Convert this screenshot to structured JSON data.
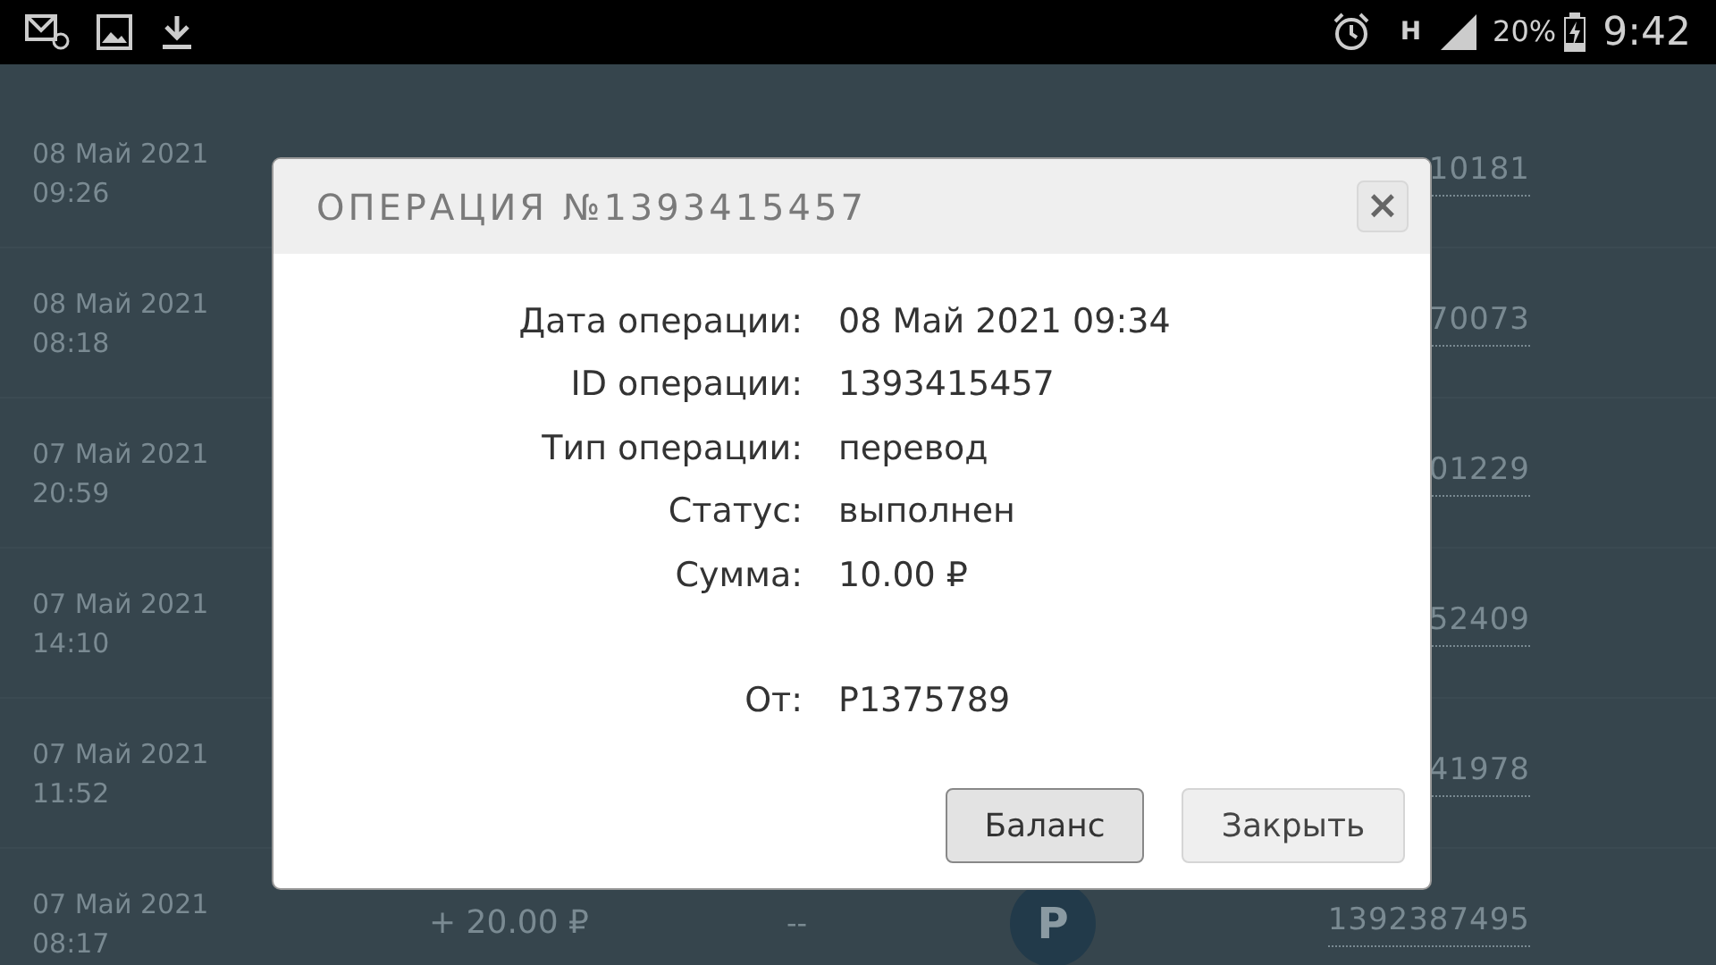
{
  "status_bar": {
    "network": "H",
    "battery": "20%",
    "time": "9:42"
  },
  "operations": [
    {
      "date": "08 Май 2021",
      "time": "09:26",
      "number": "10181"
    },
    {
      "date": "08 Май 2021",
      "time": "08:18",
      "number": "70073"
    },
    {
      "date": "07 Май 2021",
      "time": "20:59",
      "number": "01229"
    },
    {
      "date": "07 Май 2021",
      "time": "14:10",
      "number": "52409"
    },
    {
      "date": "07 Май 2021",
      "time": "11:52",
      "number": "41978"
    },
    {
      "date": "07 Май 2021",
      "time": "08:17",
      "amount": "+ 20.00 ₽",
      "sender": "--",
      "icon_letter": "P",
      "number": "1392387495"
    }
  ],
  "dialog": {
    "title": "ОПЕРАЦИЯ №1393415457",
    "close": "×",
    "fields": [
      {
        "label": "Дата операции:",
        "value": "08 Май 2021 09:34"
      },
      {
        "label": "ID операции:",
        "value": "1393415457"
      },
      {
        "label": "Тип операции:",
        "value": "перевод"
      },
      {
        "label": "Статус:",
        "value": "выполнен"
      },
      {
        "label": "Сумма:",
        "value": "10.00 ₽"
      }
    ],
    "sender": {
      "label": "От:",
      "value": "P1375789"
    },
    "buttons": [
      {
        "label": "Баланс",
        "primary": true
      },
      {
        "label": "Закрыть",
        "primary": false
      }
    ]
  }
}
